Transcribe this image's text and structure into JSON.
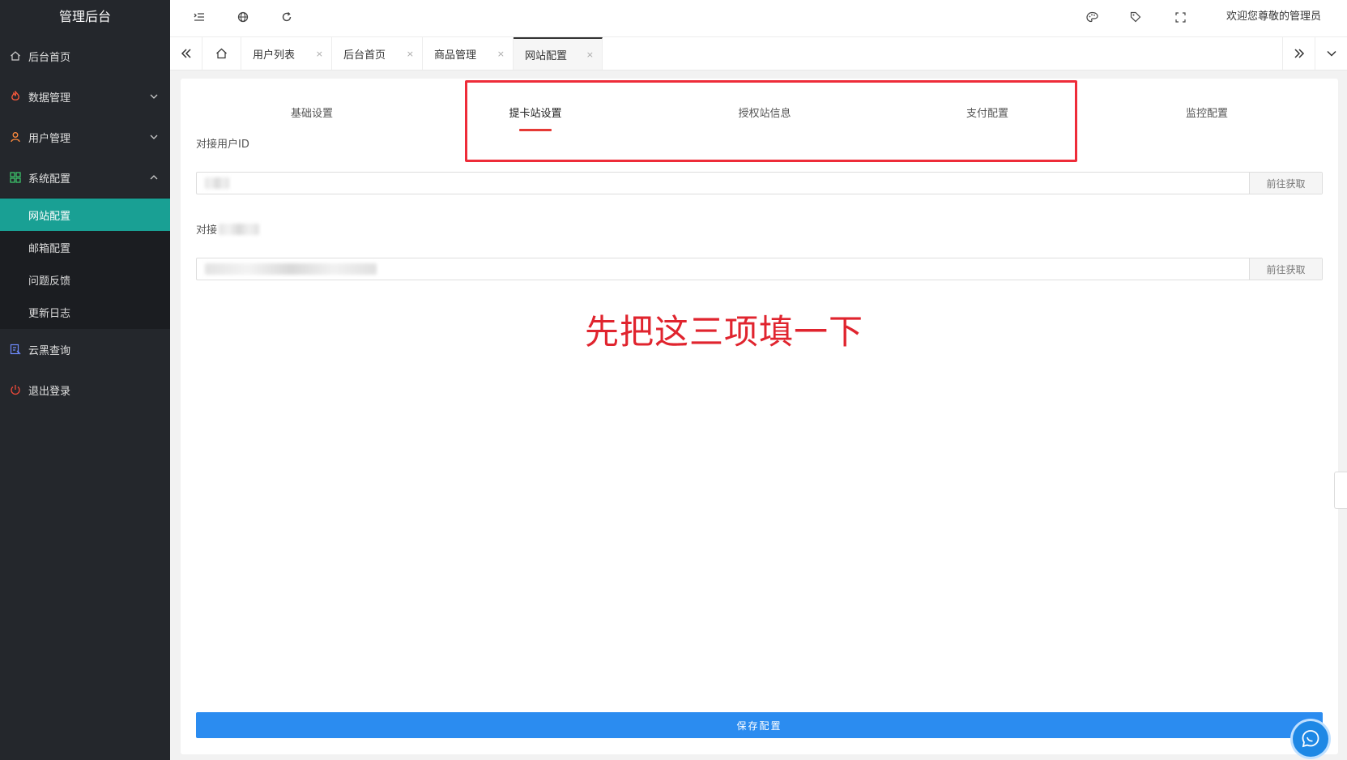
{
  "sidebar": {
    "title": "管理后台",
    "items": [
      {
        "label": "后台首页",
        "icon": "home-icon"
      },
      {
        "label": "数据管理",
        "icon": "fire-icon",
        "expandable": true
      },
      {
        "label": "用户管理",
        "icon": "user-icon",
        "expandable": true
      },
      {
        "label": "系统配置",
        "icon": "apps-icon",
        "expandable": true,
        "expanded": true
      },
      {
        "label": "云黑查询",
        "icon": "query-icon"
      },
      {
        "label": "退出登录",
        "icon": "power-icon"
      }
    ],
    "sub_items": [
      {
        "label": "网站配置",
        "active": true
      },
      {
        "label": "邮箱配置"
      },
      {
        "label": "问题反馈"
      },
      {
        "label": "更新日志"
      }
    ]
  },
  "header": {
    "welcome": "欢迎您尊敬的管理员",
    "icons": [
      "menu-fold-icon",
      "globe-icon",
      "refresh-icon",
      "palette-icon",
      "tag-icon",
      "fullscreen-icon"
    ]
  },
  "tabs": {
    "items": [
      {
        "label": "用户列表"
      },
      {
        "label": "后台首页"
      },
      {
        "label": "商品管理"
      },
      {
        "label": "网站配置",
        "active": true
      }
    ],
    "close_glyph": "×"
  },
  "config": {
    "tabs": [
      {
        "label": "基础设置"
      },
      {
        "label": "提卡站设置",
        "active": true
      },
      {
        "label": "授权站信息"
      },
      {
        "label": "支付配置"
      },
      {
        "label": "监控配置"
      }
    ],
    "fields": [
      {
        "label": "对接用户ID",
        "value": "",
        "button": "前往获取"
      },
      {
        "label": "对接",
        "value": "",
        "button": "前往获取"
      }
    ],
    "annotation": "先把这三项填一下",
    "save_label": "保存配置"
  },
  "colors": {
    "sidebar_bg": "#24272c",
    "active_green": "#19a094",
    "save_blue": "#2b8cf0",
    "annotation_red": "#e0242e",
    "fire_red": "#ff5a3c",
    "user_orange": "#ff8a3d",
    "apps_green": "#3ecf6f",
    "query_blue": "#6f8cff",
    "power_red": "#f04a3a"
  }
}
